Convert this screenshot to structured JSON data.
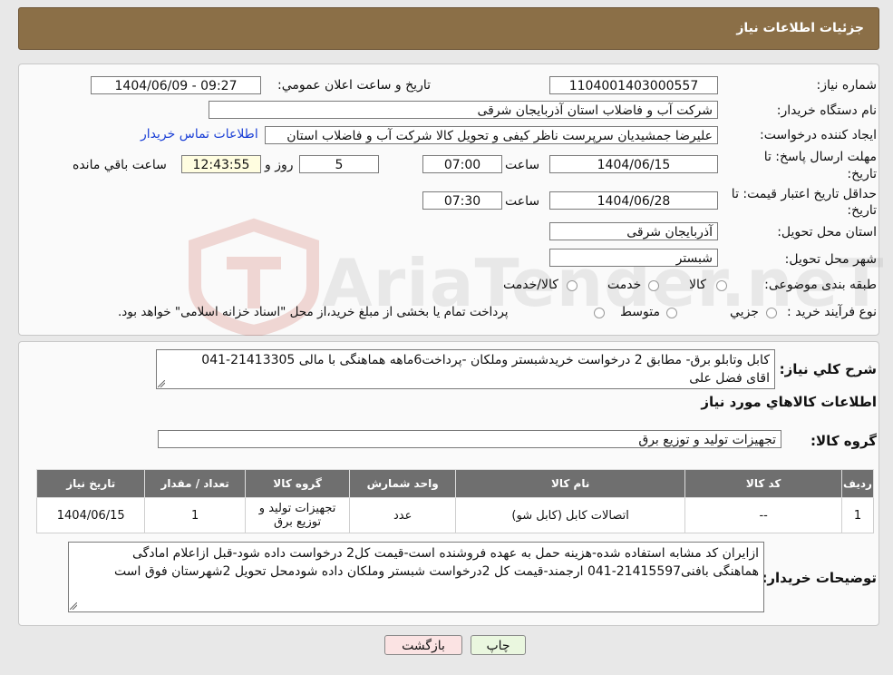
{
  "header": {
    "title": "جزئیات اطلاعات نیاز"
  },
  "fields": {
    "need_number_label": "شماره نیاز:",
    "need_number": "1104001403000557",
    "announce_label": "تاریخ و ساعت اعلان عمومي:",
    "announce_value": "1404/06/09 - 09:27",
    "buyer_org_label": "نام دستگاه خريدار:",
    "buyer_org": "شرکت آب و فاضلاب استان آذربایجان شرقی",
    "creator_label": "ايجاد کننده درخواست:",
    "creator": "علیرضا جمشیدیان سرپرست ناظر کیفی و تحویل کالا شرکت آب و فاضلاب استان",
    "contact_link": "اطلاعات تماس خريدار",
    "deadline_label_1": "مهلت ارسال پاسخ: تا",
    "deadline_label_2": "تاريخ:",
    "deadline_date": "1404/06/15",
    "time_word": "ساعت",
    "deadline_time": "07:00",
    "days": "5",
    "days_and": "روز و",
    "remaining": "12:43:55",
    "remaining_label": "ساعت باقي مانده",
    "validity_label_1": "حداقل تاريخ اعتبار قيمت: تا",
    "validity_label_2": "تاريخ:",
    "validity_date": "1404/06/28",
    "validity_time": "07:30",
    "province_label": "استان محل تحويل:",
    "province": "آذربایجان شرقی",
    "city_label": "شهر محل تحويل:",
    "city": "شبستر",
    "category_label": "طبقه بندی موضوعی:",
    "category_options": [
      "کالا",
      "خدمت",
      "کالا/خدمت"
    ],
    "process_label": "نوع فرآيند خريد :",
    "process_options": [
      "جزيي",
      "متوسط"
    ],
    "process_note": "پرداخت تمام یا بخشی از مبلغ خرید،از محل \"اسناد خزانه اسلامی\" خواهد بود."
  },
  "summary": {
    "label": "شرح کلي نياز:",
    "text_line1": "کابل وتابلو برق- مطابق 2 درخواست خریدشبستر وملکان -پرداخت6ماهه هماهنگی با مالی 21413305-041",
    "text_line2": "اقای فضل علی"
  },
  "goods": {
    "section_title": "اطلاعات کالاهاي مورد نياز",
    "group_label": "گروه کالا:",
    "group_value": "تجهیزات تولید و توزیع برق",
    "columns": [
      "رديف",
      "کد کالا",
      "نام کالا",
      "واحد شمارش",
      "گروه کالا",
      "تعداد / مقدار",
      "تاريخ نياز"
    ],
    "rows": [
      {
        "row": "1",
        "code": "--",
        "name": "اتصالات کابل (کابل شو)",
        "unit": "عدد",
        "group_1": "تجهیزات تولید و",
        "group_2": "توزیع برق",
        "qty": "1",
        "date": "1404/06/15"
      }
    ]
  },
  "buyer_notes": {
    "label": "توضيحات خريدار:",
    "line1": "ازایران کد مشابه استفاده شده-هزینه حمل به عهده فروشنده است-قیمت کل2 درخواست داده شود-قبل ازاعلام امادگی",
    "line2": "هماهنگی بافنی21415597-041 ارجمند-قیمت کل 2درخواست شبستر وملکان داده شودمحل تحویل 2شهرستان فوق است"
  },
  "buttons": {
    "print": "چاپ",
    "back": "بازگشت"
  },
  "colors": {
    "header": "#8b6f47",
    "table_header": "#6f6f6f",
    "print_btn": "#eaf7df",
    "back_btn": "#fbe3e3",
    "link": "#1a3fd6"
  },
  "watermark": "AriaTender.neT"
}
